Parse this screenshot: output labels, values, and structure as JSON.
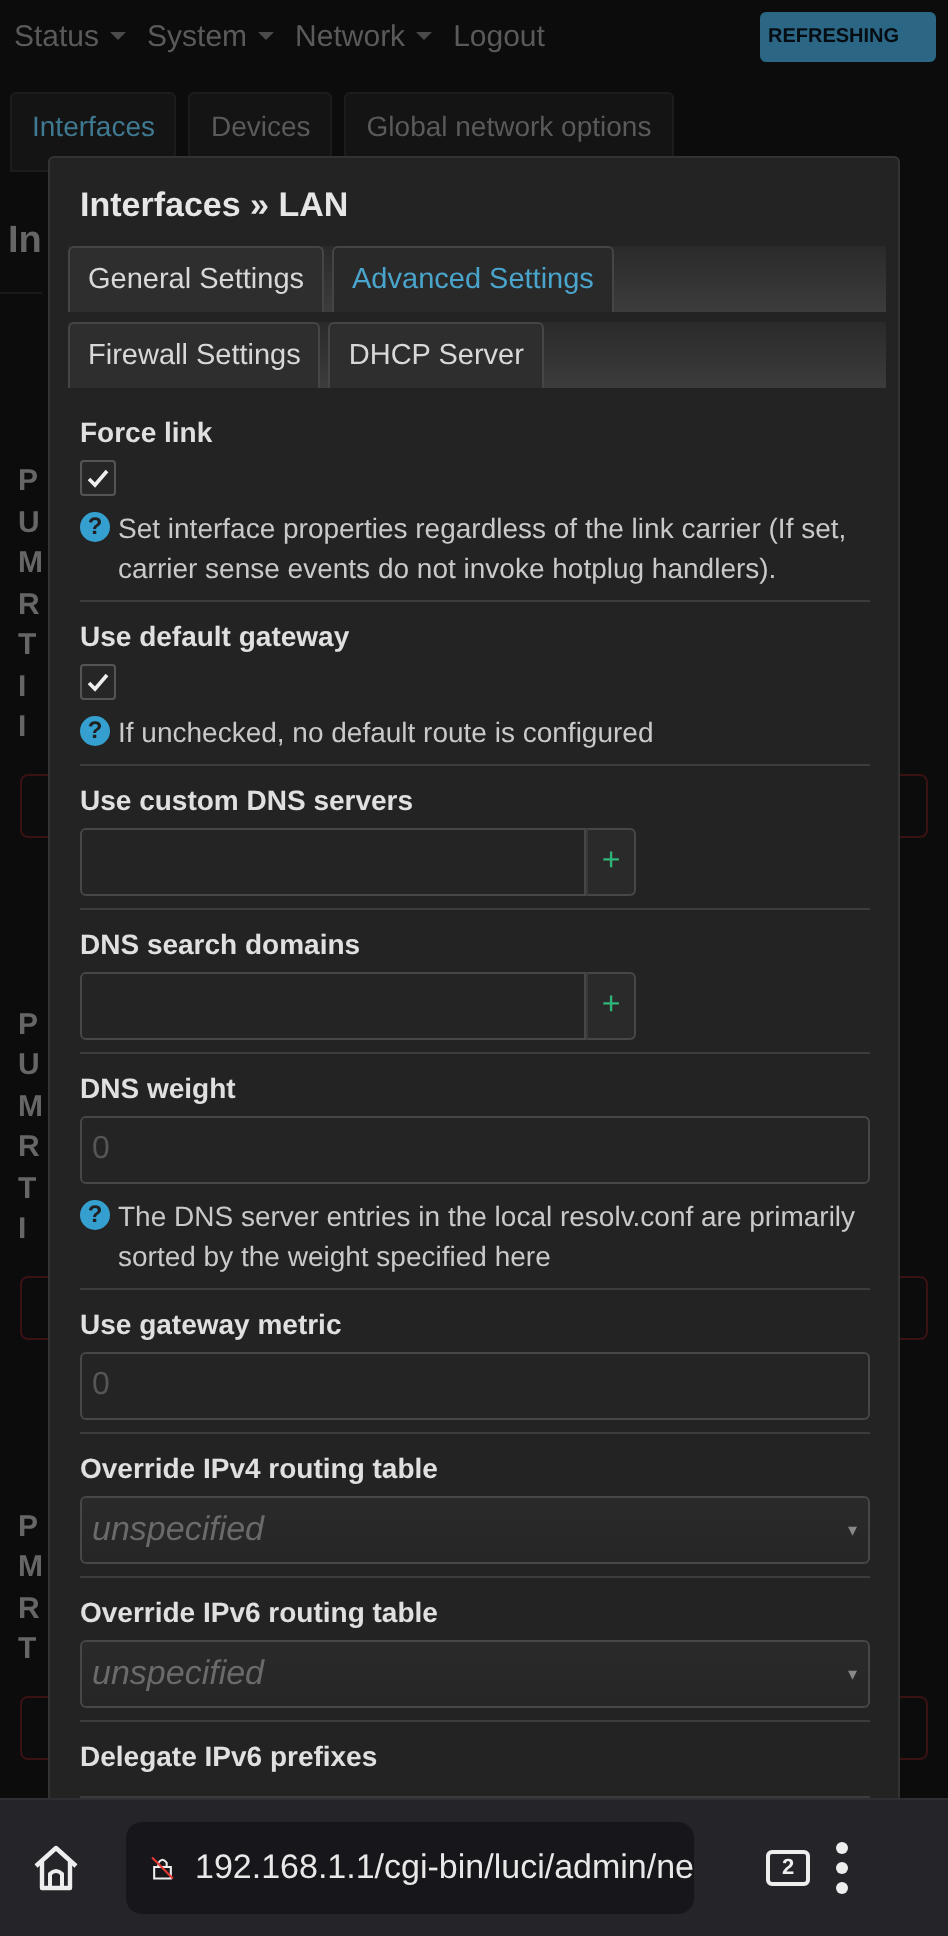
{
  "nav": {
    "items": [
      {
        "label": "Status",
        "has_menu": true
      },
      {
        "label": "System",
        "has_menu": true
      },
      {
        "label": "Network",
        "has_menu": true
      },
      {
        "label": "Logout",
        "has_menu": false
      }
    ],
    "indicator": "REFRESHING"
  },
  "page_tabs": [
    {
      "label": "Interfaces",
      "selected": true
    },
    {
      "label": "Devices",
      "selected": false
    },
    {
      "label": "Global network options",
      "selected": false
    }
  ],
  "page_heading": "In",
  "background_groups": [
    {
      "lines": [
        "P",
        "U",
        "M",
        "R",
        "T",
        "I",
        "I"
      ]
    },
    {
      "lines": [
        "P",
        "U",
        "M",
        "R",
        "T",
        "I"
      ]
    },
    {
      "lines": [
        "P",
        "M",
        "R",
        "T"
      ]
    }
  ],
  "dialog": {
    "title": "Interfaces » LAN",
    "tab_rows": [
      [
        {
          "label": "General Settings",
          "selected": false
        },
        {
          "label": "Advanced Settings",
          "selected": true
        }
      ],
      [
        {
          "label": "Firewall Settings",
          "selected": false
        },
        {
          "label": "DHCP Server",
          "selected": false
        }
      ]
    ],
    "fields": [
      {
        "kind": "checkbox",
        "label": "Force link",
        "checked": true,
        "help_icon": "?",
        "help": "Set interface properties regardless of the link carrier (If set, carrier sense events do not invoke hotplug handlers)."
      },
      {
        "kind": "checkbox",
        "label": "Use default gateway",
        "checked": true,
        "help_icon": "?",
        "help": "If unchecked, no default route is configured"
      },
      {
        "kind": "dynlist",
        "label": "Use custom DNS servers",
        "add": "+"
      },
      {
        "kind": "dynlist",
        "label": "DNS search domains",
        "add": "+"
      },
      {
        "kind": "text",
        "label": "DNS weight",
        "placeholder": "0",
        "help_icon": "?",
        "help": "The DNS server entries in the local resolv.conf are primarily sorted by the weight specified here"
      },
      {
        "kind": "text",
        "label": "Use gateway metric",
        "placeholder": "0"
      },
      {
        "kind": "select",
        "label": "Override IPv4 routing table",
        "value": "unspecified",
        "caret": "▾"
      },
      {
        "kind": "select",
        "label": "Override IPv6 routing table",
        "value": "unspecified",
        "caret": "▾"
      },
      {
        "kind": "label",
        "label": "Delegate IPv6 prefixes"
      }
    ]
  },
  "browser_bar": {
    "url": "192.168.1.1/cgi-bin/luci/admin/ne",
    "tab_count": "2"
  }
}
